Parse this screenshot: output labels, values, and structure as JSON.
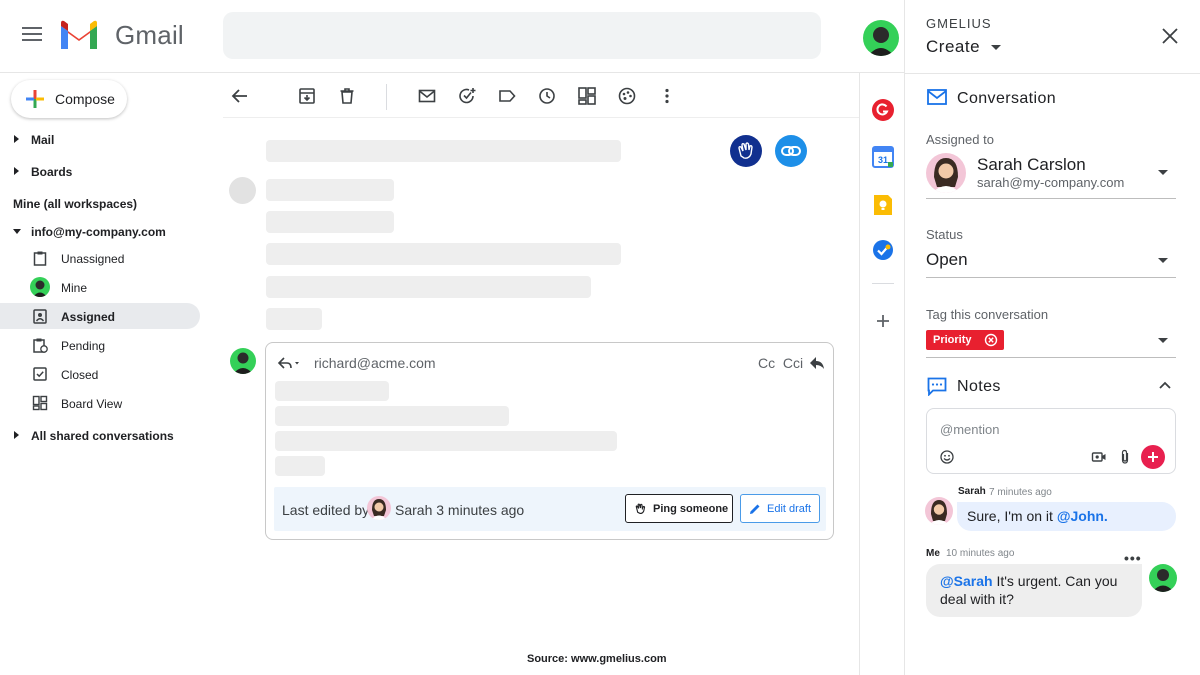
{
  "header": {
    "brand": "Gmail",
    "menu_icon": "hamburger-menu-icon",
    "search_placeholder": ""
  },
  "nav": {
    "compose_label": "Compose",
    "mail_label": "Mail",
    "boards_label": "Boards",
    "mine_all_label": "Mine (all workspaces)",
    "mailbox_label": "info@my-company.com",
    "items": [
      {
        "label": "Unassigned",
        "icon": "clipboard-icon"
      },
      {
        "label": "Mine",
        "icon": "avatar"
      },
      {
        "label": "Assigned",
        "icon": "assigned-badge-icon",
        "active": true
      },
      {
        "label": "Pending",
        "icon": "pending-clipboard-icon"
      },
      {
        "label": "Closed",
        "icon": "checkbox-icon"
      },
      {
        "label": "Board View",
        "icon": "board-view-icon"
      }
    ],
    "shared_label": "All shared conversations"
  },
  "reply": {
    "to": "richard@acme.com",
    "cc": "Cc",
    "cci": "Cci",
    "last_edited_prefix": "Last edited by",
    "last_edited_by": "Sarah 3 minutes ago",
    "ping_label": "Ping someone",
    "edit_label": "Edit draft"
  },
  "source": "Source: www.gmelius.com",
  "panel": {
    "brand": "GMELIUS",
    "create_label": "Create",
    "conversation_title": "Conversation",
    "assigned_label": "Assigned to",
    "assignee_name": "Sarah Carslon",
    "assignee_email": "sarah@my-company.com",
    "status_label": "Status",
    "status_value": "Open",
    "tag_label": "Tag this conversation",
    "tag_value": "Priority",
    "notes_title": "Notes",
    "note_placeholder": "@mention",
    "comments": [
      {
        "author": "Sarah",
        "time": "7 minutes ago",
        "text": "Sure, I'm on it ",
        "mention": "@John."
      },
      {
        "author": "Me",
        "time": "10 minutes ago",
        "mention": "@Sarah",
        "text": " It's urgent. Can you deal with it?"
      }
    ]
  },
  "colors": {
    "accent_blue": "#1a73e8",
    "priority_red": "#e8202f",
    "active_nav": "#e8eaed"
  }
}
